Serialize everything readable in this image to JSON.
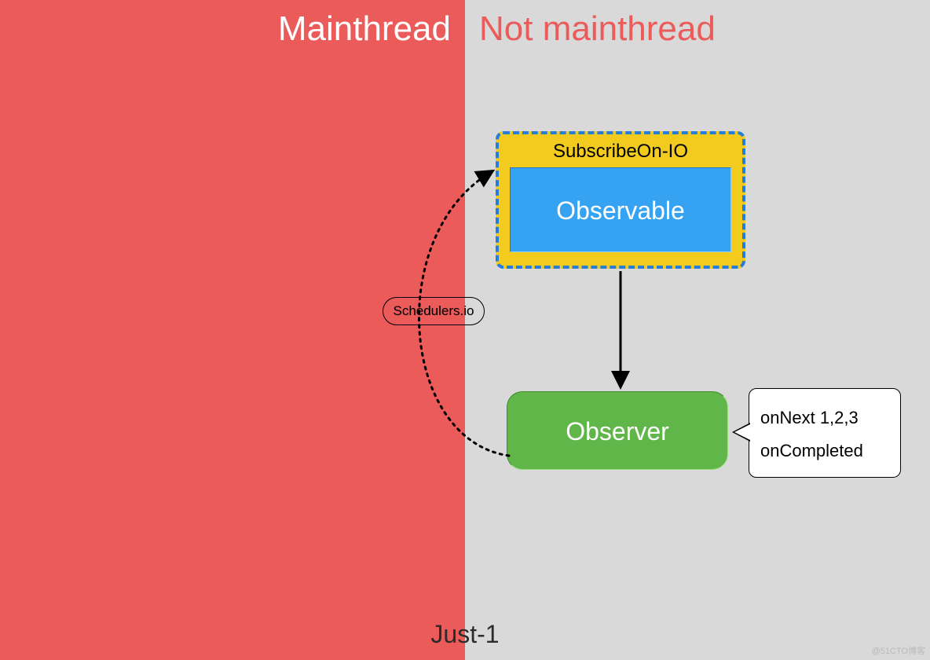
{
  "headings": {
    "left": "Mainthread",
    "right": "Not mainthread"
  },
  "subscribe": {
    "label": "SubscribeOn-IO",
    "observable": "Observable"
  },
  "observer": "Observer",
  "callout": {
    "line1": "onNext  1,2,3",
    "line2": "onCompleted"
  },
  "schedulers": "Schedulers.io",
  "footer": "Just-1",
  "watermark": "@51CTO博客",
  "colors": {
    "main_bg": "#eb5b59",
    "side_bg": "#d9d9d9",
    "yellow": "#f3cb1e",
    "blue_dash": "#247dd9",
    "observable_blue": "#35a3f2",
    "observer_green": "#60b648"
  }
}
